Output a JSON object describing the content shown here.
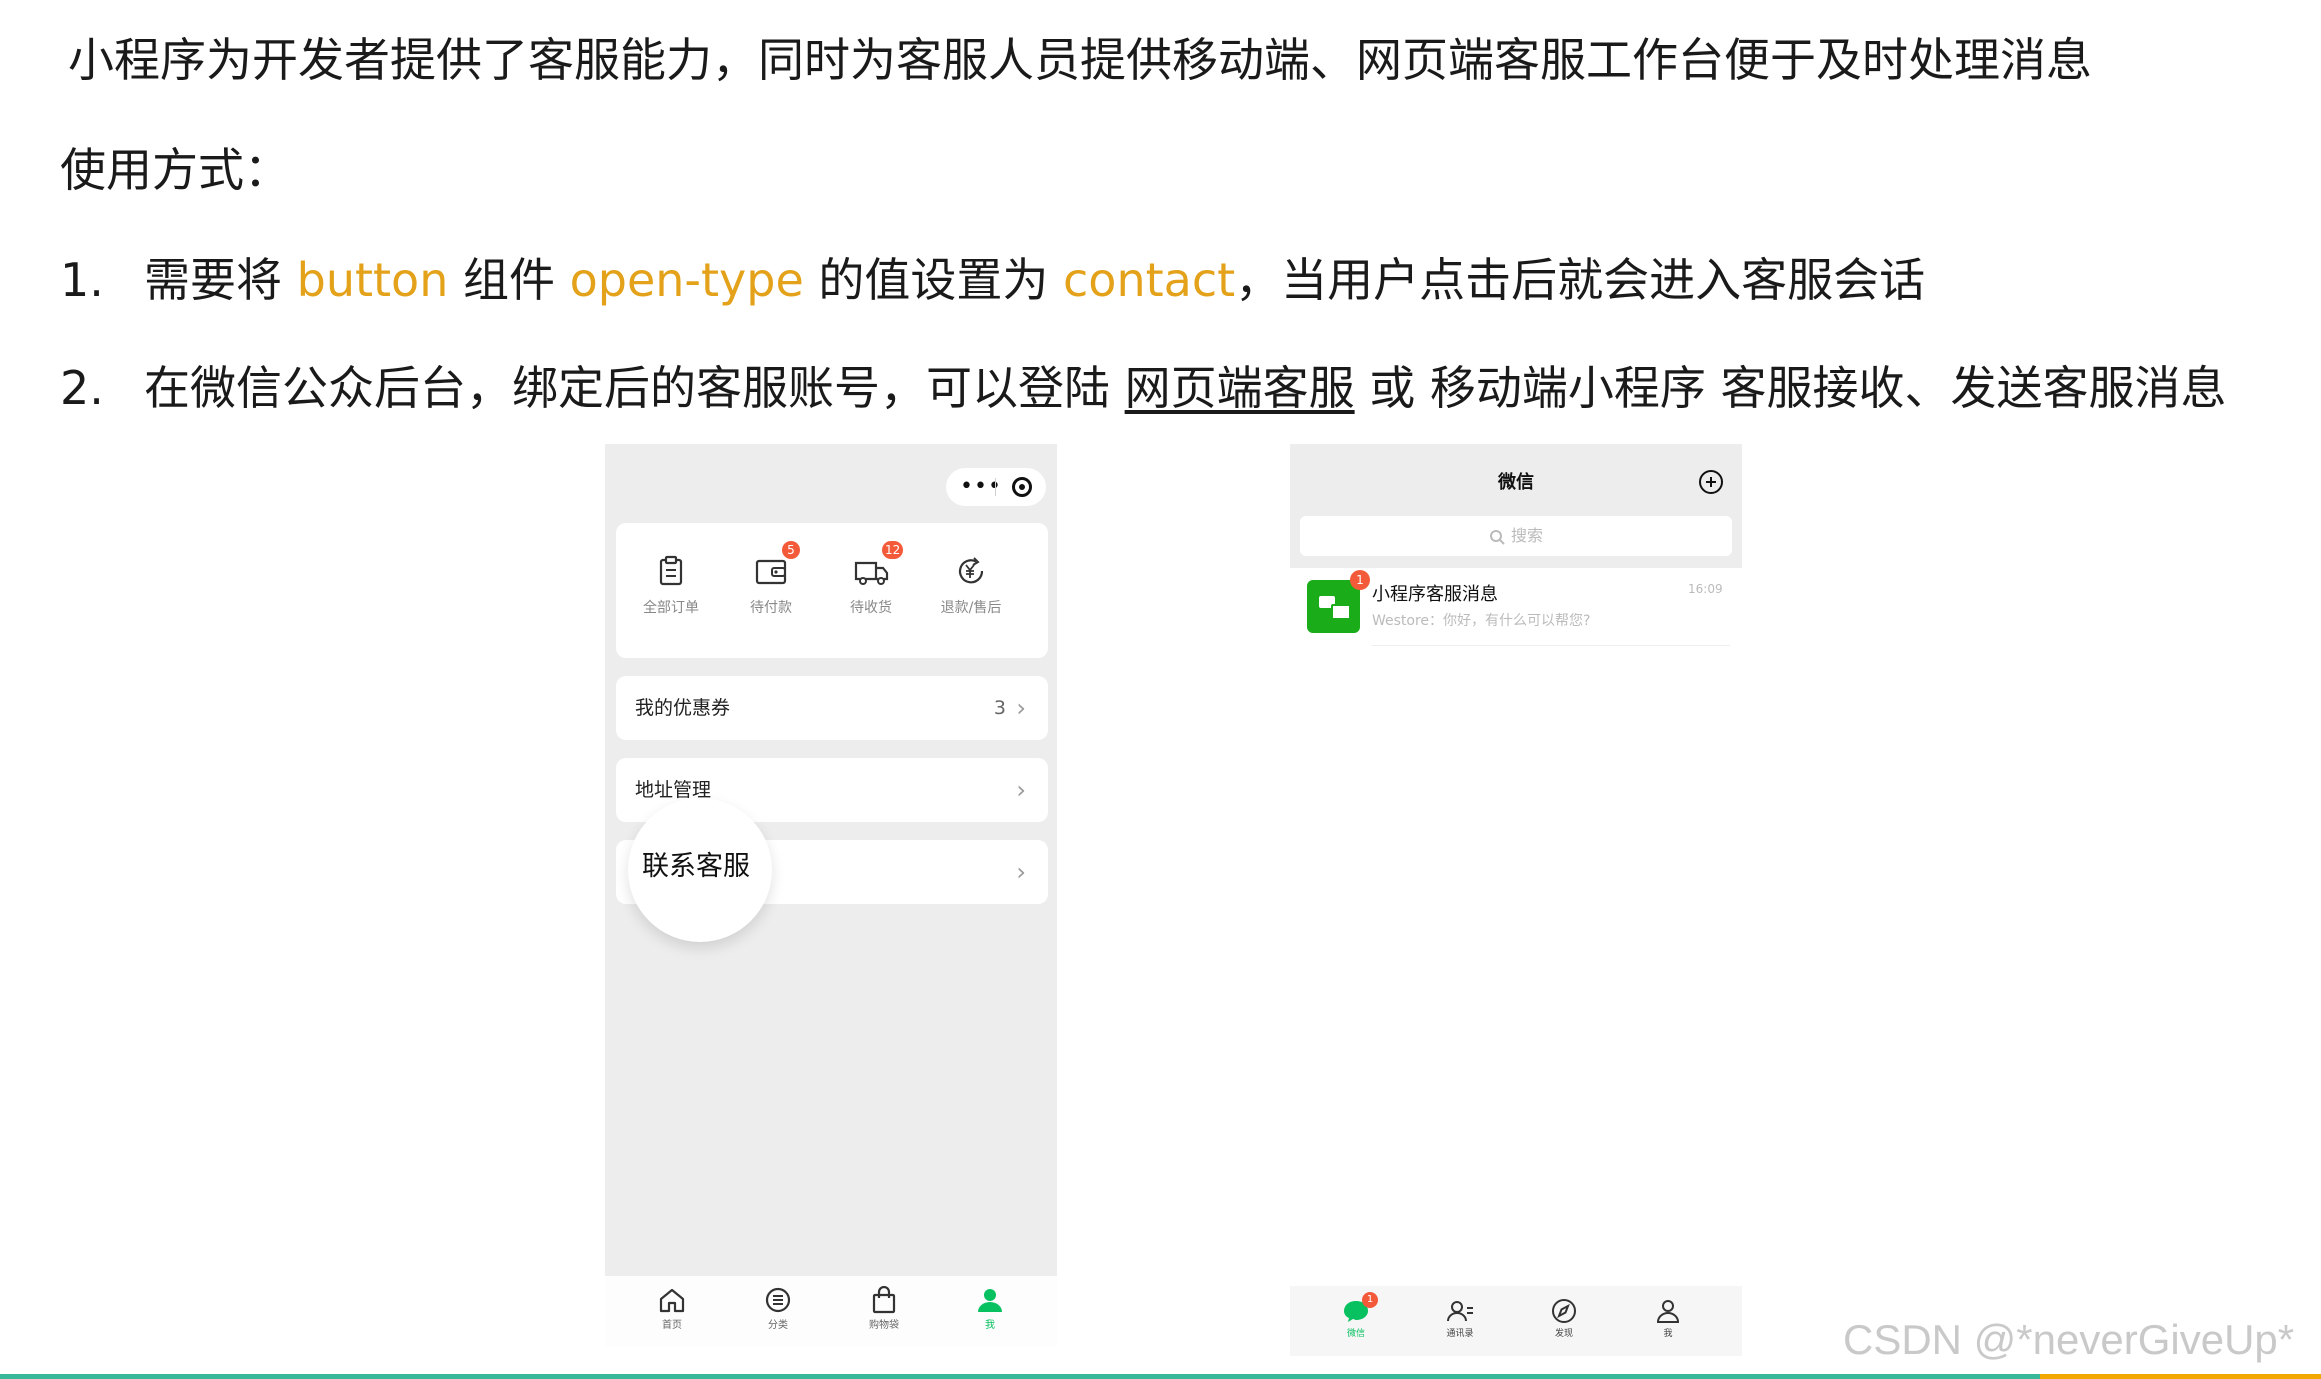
{
  "intro": {
    "line1": "小程序为开发者提供了客服能力，同时为客服人员提供移动端、网页端客服工作台便于及时处理消息",
    "usage_heading": "使用方式：",
    "step1": {
      "num": "1.",
      "t1": "需要将 ",
      "k1": "button",
      "t2": " 组件 ",
      "k2": "open-type",
      "t3": " 的值设置为 ",
      "k3": "contact",
      "t4": "，当用户点击后就会进入客服会话"
    },
    "step2": {
      "num": "2.",
      "t1": "在微信公众后台，绑定后的客服账号，可以登陆 ",
      "link": "网页端客服",
      "t2": " 或 移动端小程序 客服接收、发送客服消息"
    }
  },
  "phone1": {
    "capsule": {
      "dots": "•••"
    },
    "orders": [
      {
        "label": "全部订单",
        "icon": "clipboard-icon",
        "badge": ""
      },
      {
        "label": "待付款",
        "icon": "wallet-icon",
        "badge": "5"
      },
      {
        "label": "待收货",
        "icon": "truck-icon",
        "badge": "12"
      },
      {
        "label": "退款/售后",
        "icon": "refund-icon",
        "badge": ""
      }
    ],
    "coupon": {
      "label": "我的优惠券",
      "count": "3"
    },
    "address": {
      "label": "地址管理"
    },
    "contact": {
      "label": "联系客服"
    },
    "tabs": [
      {
        "label": "首页",
        "icon": "home-icon"
      },
      {
        "label": "分类",
        "icon": "category-icon"
      },
      {
        "label": "购物袋",
        "icon": "bag-icon"
      },
      {
        "label": "我",
        "icon": "user-icon"
      }
    ],
    "accent": "#07c160"
  },
  "phone2": {
    "title": "微信",
    "search_placeholder": "搜索",
    "chat": {
      "name": "小程序客服消息",
      "time": "16:09",
      "preview": "Westore：你好，有什么可以帮您?",
      "badge": "1"
    },
    "tabs": [
      {
        "label": "微信",
        "icon": "chat-icon",
        "badge": "1"
      },
      {
        "label": "通讯录",
        "icon": "contacts-icon"
      },
      {
        "label": "发现",
        "icon": "compass-icon"
      },
      {
        "label": "我",
        "icon": "user-icon"
      }
    ]
  },
  "watermark": "CSDN @*neverGiveUp*"
}
